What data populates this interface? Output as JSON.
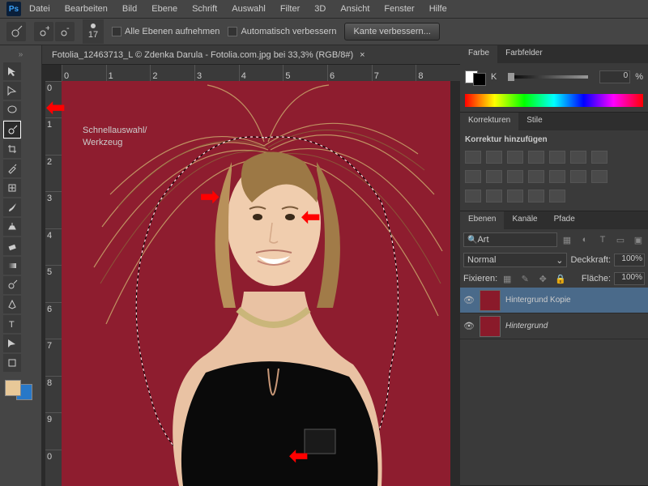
{
  "menu": {
    "items": [
      "Datei",
      "Bearbeiten",
      "Bild",
      "Ebene",
      "Schrift",
      "Auswahl",
      "Filter",
      "3D",
      "Ansicht",
      "Fenster",
      "Hilfe"
    ]
  },
  "optbar": {
    "brush_size": "17",
    "chk1": "Alle Ebenen aufnehmen",
    "chk2": "Automatisch verbessern",
    "refine": "Kante verbessern..."
  },
  "doc": {
    "title": "Fotolia_12463713_L © Zdenka Darula - Fotolia.com.jpg bei 33,3% (RGB/8#)"
  },
  "label": {
    "l1": "Schnellauswahl/",
    "l2": "Werkzeug"
  },
  "panels": {
    "color": {
      "tabs": [
        "Farbe",
        "Farbfelder"
      ],
      "label": "K",
      "value": "0",
      "pct": "%"
    },
    "adjust": {
      "tabs": [
        "Korrekturen",
        "Stile"
      ],
      "title": "Korrektur hinzufügen"
    },
    "layers": {
      "tabs": [
        "Ebenen",
        "Kanäle",
        "Pfade"
      ],
      "kind": "Art",
      "mode": "Normal",
      "opacity_lbl": "Deckkraft:",
      "opacity": "100%",
      "lock": "Fixieren:",
      "fill_lbl": "Fläche:",
      "fill": "100%",
      "items": [
        {
          "name": "Hintergrund Kopie"
        },
        {
          "name": "Hintergrund"
        }
      ]
    }
  },
  "ruler_h": [
    "0",
    "1",
    "2",
    "3",
    "4",
    "5",
    "6",
    "7",
    "8"
  ],
  "ruler_v": [
    "0",
    "1",
    "2",
    "3",
    "4",
    "5",
    "6",
    "7",
    "8",
    "9",
    "0"
  ]
}
